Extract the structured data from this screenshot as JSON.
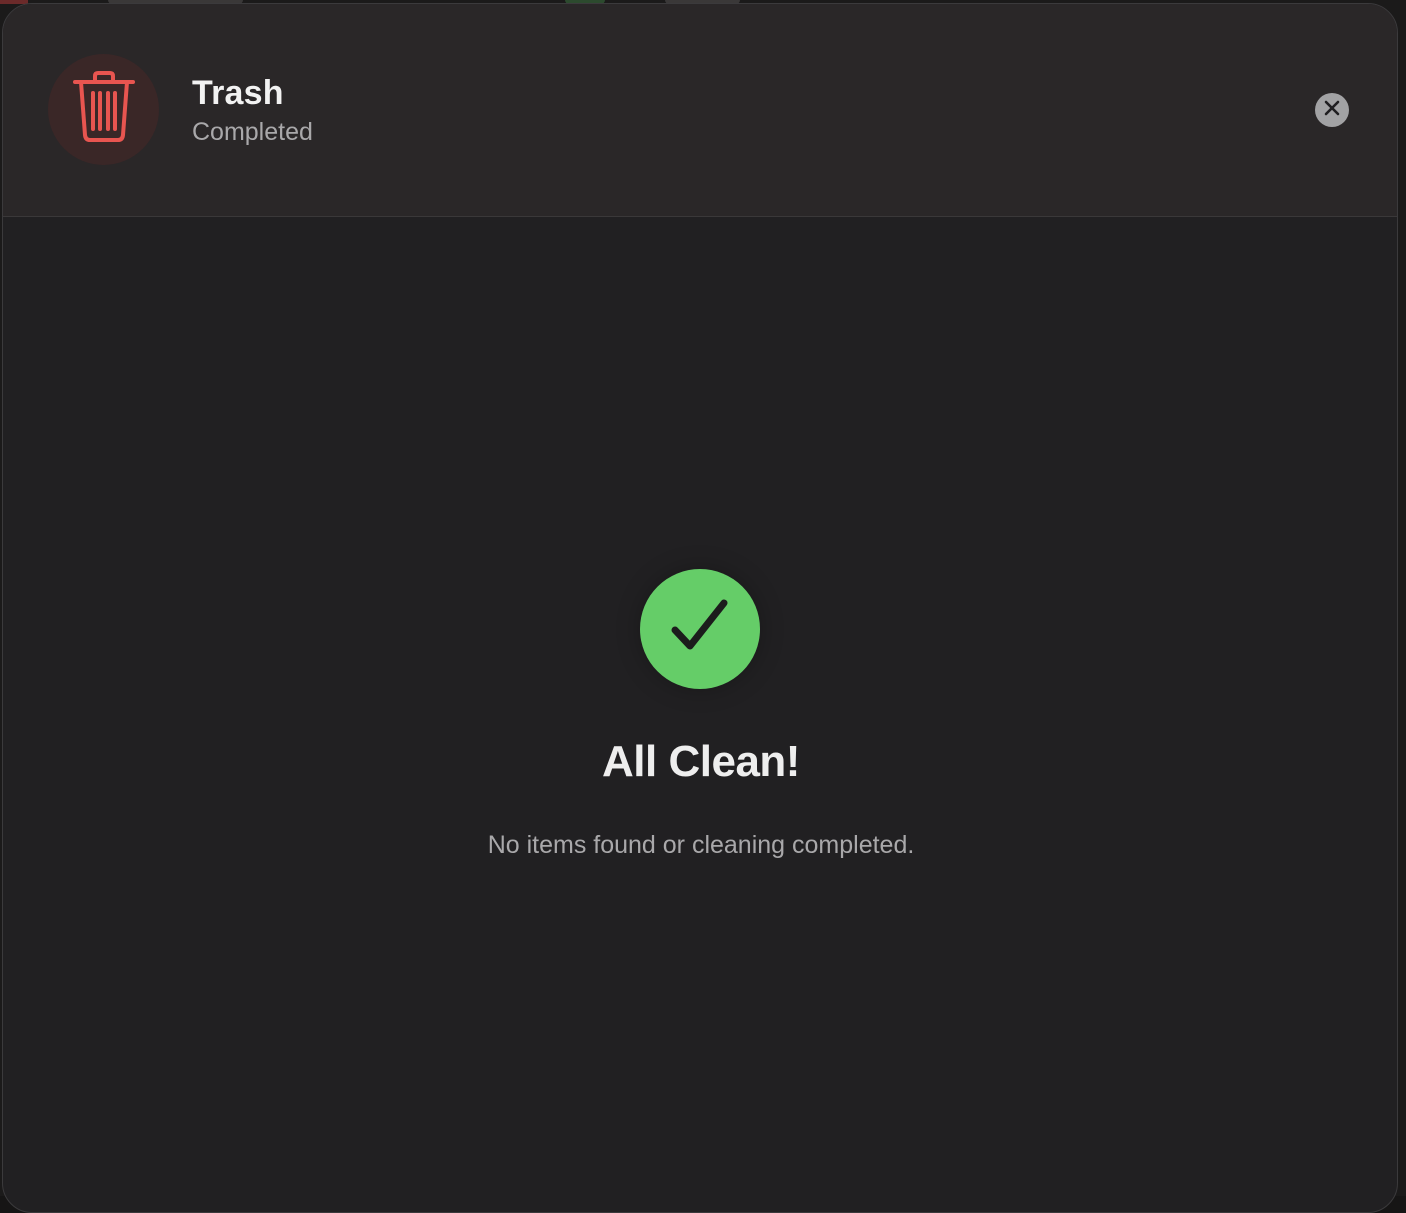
{
  "header": {
    "title": "Trash",
    "status": "Completed",
    "icon": "trash-icon",
    "accent_color": "#e85550",
    "close_icon": "close-icon"
  },
  "result": {
    "icon": "checkmark-icon",
    "success_color": "#65cd68",
    "title": "All Clean!",
    "message": "No items found or cleaning completed."
  }
}
